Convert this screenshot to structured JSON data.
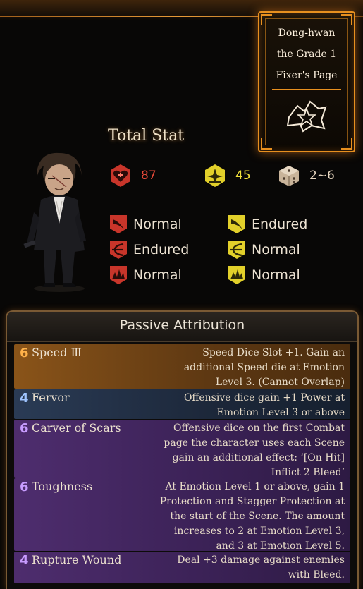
{
  "key_page": {
    "title": "Dong-hwan\nthe Grade 1\nFixer's Page",
    "emblem_icon": "star-emblem-icon",
    "accent_color": "#e8901f"
  },
  "character": {
    "icon": "fixer-character-sprite"
  },
  "total_stat": {
    "label": "Total Stat",
    "hp": {
      "icon": "health-icon",
      "value": "87",
      "color": "#e94a3a"
    },
    "stagger": {
      "icon": "stagger-icon",
      "value": "45",
      "color": "#f2e23a"
    },
    "speed": {
      "icon": "speed-dice-icon",
      "value": "2~6",
      "color": "#e8d7c0"
    }
  },
  "resistances": {
    "hp": [
      {
        "icon": "slash-resist-icon",
        "label": "Normal"
      },
      {
        "icon": "pierce-resist-icon",
        "label": "Endured"
      },
      {
        "icon": "blunt-resist-icon",
        "label": "Normal"
      }
    ],
    "stagger": [
      {
        "icon": "slash-stagger-resist-icon",
        "label": "Endured"
      },
      {
        "icon": "pierce-stagger-resist-icon",
        "label": "Normal"
      },
      {
        "icon": "blunt-stagger-resist-icon",
        "label": "Normal"
      }
    ]
  },
  "passives": {
    "title": "Passive Attribution",
    "items": [
      {
        "cost": "6",
        "name": "Speed Ⅲ",
        "color": "orange",
        "description": "Speed Dice Slot +1. Gain an additional Speed die at Emotion Level 3. (Cannot Overlap)"
      },
      {
        "cost": "4",
        "name": "Fervor",
        "color": "blue",
        "description": "Offensive dice gain +1 Power at Emotion Level 3 or above"
      },
      {
        "cost": "6",
        "name": "Carver of Scars",
        "color": "purple",
        "description": "Offensive dice on the first Combat page the character uses each Scene gain an additional effect: ‘[On Hit] Inflict 2 Bleed’"
      },
      {
        "cost": "6",
        "name": "Toughness",
        "color": "purple",
        "description": "At Emotion Level 1 or above, gain 1 Protection and Stagger Protection at the start of the Scene. The amount increases to 2 at Emotion Level 3, and 3 at Emotion Level 5."
      },
      {
        "cost": "4",
        "name": "Rupture Wound",
        "color": "purple",
        "description": "Deal +3 damage against enemies with Bleed."
      }
    ]
  }
}
